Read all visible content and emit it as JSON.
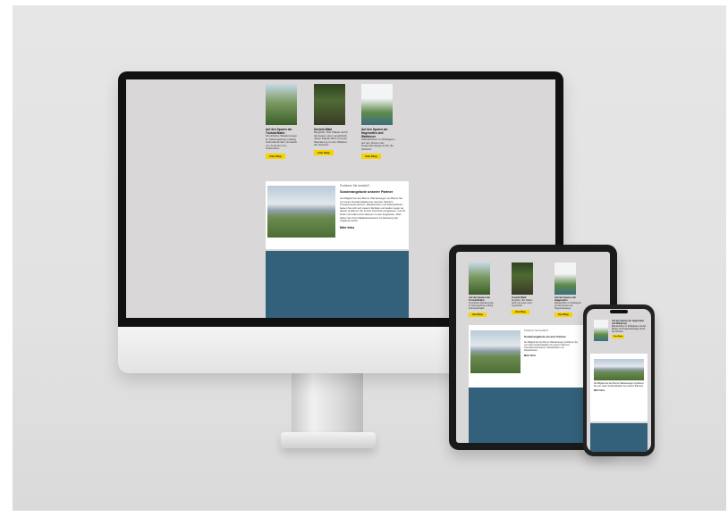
{
  "page": {
    "books": [
      {
        "title": "Auf den Spuren der Troisdorfbahn",
        "description": "33 einfache Wanderungen im Siebengebirge entlang Kulturdenkmäler. Entdeckt von Jena bis zum Ostbrocken.",
        "button": "Zum Shop"
      },
      {
        "title": "Unsicht Wald",
        "description": "Bergfahrt. Wie Wälder durch die Augen einer Landschaft. Jedes Kapitel führt mit einer Wanderung zu den Wäldern der Schweiz.",
        "button": "Zum Shop"
      },
      {
        "title": "Auf den Spuren der Hugenotten und Waldenser",
        "description": "Wanderführer in 29 Etappen auf den Routen der Hugenottenwege durch die Schweiz.",
        "button": "Zum Shop"
      }
    ],
    "teaser": {
      "kicker": "Probieren Sie bewährt?",
      "heading": "Sonderangebote unserer Partner",
      "body": "Als Mitglied bei den Berner Wanderwegen profitieren Sie von vielen Sonderrabatten bei unseren Partnern. Transportunternehmen, Wanderferien und Reiseanbieter - besten Sie sich auf unserer Website und kaufen Lager an, darauf profitieren Sie bereits Gutschein-Angeboten, und Ihr finden sich alles Informationen zu den Angeboten. Alles haben Sie Ihren Mitgliederausweis zur Einlösung der Angebote bereit.",
      "more": "Mehr Infos"
    }
  },
  "tablet": {
    "books": [
      {
        "title": "Auf den Spuren der Troisdorfbahn",
        "description": "33 einfache Wanderungen im Siebengebirge entlang Kulturdenkmäler.",
        "button": "Zum Shop"
      },
      {
        "title": "Unsicht Wald",
        "description": "Bergfahrt. Wie Wälder durch die Augen einer Landschaft.",
        "button": "Zum Shop"
      },
      {
        "title": "Auf den Spuren der Hugenotten",
        "description": "Wanderführer in 29 Etappen auf den Routen der Hugenottenwege.",
        "button": "Zum Shop"
      }
    ],
    "teaser": {
      "kicker": "Probieren Sie bewährt?",
      "heading": "Sonderangebote unserer Partner",
      "body": "Als Mitglied bei den Berner Wanderwegen profitieren Sie von vielen Sonderrabatten bei unseren Partnern. Transportunternehmen, Wanderferien und Reiseanbieter.",
      "more": "Mehr Infos"
    }
  },
  "phone": {
    "book_title": "Auf den Spuren der Hugenotten und Waldenser",
    "book_desc": "Wanderführer in 29 Etappen auf den Routen der Hugenottenwege durch die Schweiz.",
    "button": "Zum Shop",
    "teaser_body": "Als Mitglied bei den Berner Wanderwegen profitieren Sie von vielen Sonderrabatten bei unseren Partnern.",
    "more": "Mehr Infos"
  }
}
